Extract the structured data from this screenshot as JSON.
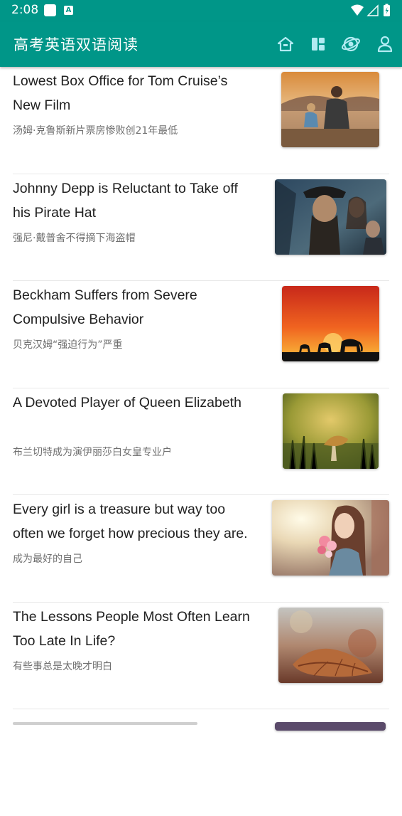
{
  "status_bar": {
    "time": "2:08",
    "icons": [
      "notification-square-icon",
      "a-badge-icon",
      "wifi-icon",
      "signal-icon",
      "battery-icon"
    ]
  },
  "app_bar": {
    "title": "高考英语双语阅读",
    "actions": [
      "home-icon",
      "layout-icon",
      "planet-icon",
      "user-icon"
    ],
    "background_color": "#009688"
  },
  "articles": [
    {
      "title": "Lowest Box Office for Tom Cruise’s New Film",
      "subtitle": "汤姆·克鲁斯新片票房惨败创21年最低",
      "thumbnail": "father-and-child-at-lake-photo"
    },
    {
      "title": "Johnny Depp is Reluctant to Take off his Pirate Hat",
      "subtitle": "强尼·戴普舍不得摘下海盗帽",
      "thumbnail": "pirate-movie-poster-photo"
    },
    {
      "title": "Beckham Suffers from Severe Compulsive Behavior",
      "subtitle": "贝克汉姆“强迫行为”严重",
      "thumbnail": "elephants-at-sunset-photo"
    },
    {
      "title": "A Devoted Player of Queen Elizabeth",
      "subtitle": "布兰切特成为演伊丽莎白女皇专业户",
      "thumbnail": "mushroom-in-grass-photo"
    },
    {
      "title": "Every girl is a treasure but way too often we forget how precious they are.",
      "subtitle": "成为最好的自己",
      "thumbnail": "girl-with-flowers-photo"
    },
    {
      "title": "The Lessons People Most Often Learn Too Late In Life?",
      "subtitle": "有些事总是太晚才明白",
      "thumbnail": "autumn-leaf-photo"
    }
  ]
}
